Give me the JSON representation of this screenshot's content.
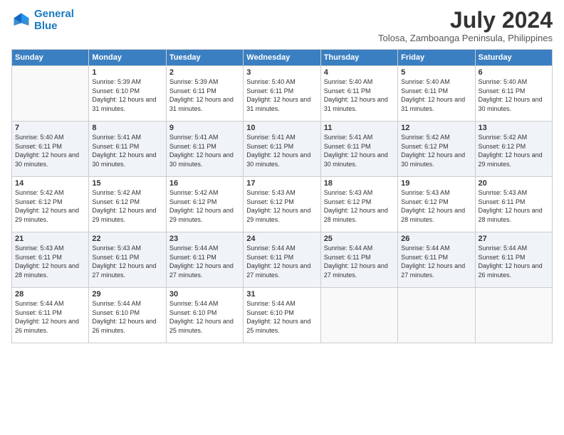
{
  "logo": {
    "line1": "General",
    "line2": "Blue"
  },
  "title": "July 2024",
  "location": "Tolosa, Zamboanga Peninsula, Philippines",
  "headers": [
    "Sunday",
    "Monday",
    "Tuesday",
    "Wednesday",
    "Thursday",
    "Friday",
    "Saturday"
  ],
  "weeks": [
    [
      {
        "day": "",
        "sunrise": "",
        "sunset": "",
        "daylight": ""
      },
      {
        "day": "1",
        "sunrise": "Sunrise: 5:39 AM",
        "sunset": "Sunset: 6:10 PM",
        "daylight": "Daylight: 12 hours and 31 minutes."
      },
      {
        "day": "2",
        "sunrise": "Sunrise: 5:39 AM",
        "sunset": "Sunset: 6:11 PM",
        "daylight": "Daylight: 12 hours and 31 minutes."
      },
      {
        "day": "3",
        "sunrise": "Sunrise: 5:40 AM",
        "sunset": "Sunset: 6:11 PM",
        "daylight": "Daylight: 12 hours and 31 minutes."
      },
      {
        "day": "4",
        "sunrise": "Sunrise: 5:40 AM",
        "sunset": "Sunset: 6:11 PM",
        "daylight": "Daylight: 12 hours and 31 minutes."
      },
      {
        "day": "5",
        "sunrise": "Sunrise: 5:40 AM",
        "sunset": "Sunset: 6:11 PM",
        "daylight": "Daylight: 12 hours and 31 minutes."
      },
      {
        "day": "6",
        "sunrise": "Sunrise: 5:40 AM",
        "sunset": "Sunset: 6:11 PM",
        "daylight": "Daylight: 12 hours and 30 minutes."
      }
    ],
    [
      {
        "day": "7",
        "sunrise": "Sunrise: 5:40 AM",
        "sunset": "Sunset: 6:11 PM",
        "daylight": "Daylight: 12 hours and 30 minutes."
      },
      {
        "day": "8",
        "sunrise": "Sunrise: 5:41 AM",
        "sunset": "Sunset: 6:11 PM",
        "daylight": "Daylight: 12 hours and 30 minutes."
      },
      {
        "day": "9",
        "sunrise": "Sunrise: 5:41 AM",
        "sunset": "Sunset: 6:11 PM",
        "daylight": "Daylight: 12 hours and 30 minutes."
      },
      {
        "day": "10",
        "sunrise": "Sunrise: 5:41 AM",
        "sunset": "Sunset: 6:11 PM",
        "daylight": "Daylight: 12 hours and 30 minutes."
      },
      {
        "day": "11",
        "sunrise": "Sunrise: 5:41 AM",
        "sunset": "Sunset: 6:11 PM",
        "daylight": "Daylight: 12 hours and 30 minutes."
      },
      {
        "day": "12",
        "sunrise": "Sunrise: 5:42 AM",
        "sunset": "Sunset: 6:12 PM",
        "daylight": "Daylight: 12 hours and 30 minutes."
      },
      {
        "day": "13",
        "sunrise": "Sunrise: 5:42 AM",
        "sunset": "Sunset: 6:12 PM",
        "daylight": "Daylight: 12 hours and 29 minutes."
      }
    ],
    [
      {
        "day": "14",
        "sunrise": "Sunrise: 5:42 AM",
        "sunset": "Sunset: 6:12 PM",
        "daylight": "Daylight: 12 hours and 29 minutes."
      },
      {
        "day": "15",
        "sunrise": "Sunrise: 5:42 AM",
        "sunset": "Sunset: 6:12 PM",
        "daylight": "Daylight: 12 hours and 29 minutes."
      },
      {
        "day": "16",
        "sunrise": "Sunrise: 5:42 AM",
        "sunset": "Sunset: 6:12 PM",
        "daylight": "Daylight: 12 hours and 29 minutes."
      },
      {
        "day": "17",
        "sunrise": "Sunrise: 5:43 AM",
        "sunset": "Sunset: 6:12 PM",
        "daylight": "Daylight: 12 hours and 29 minutes."
      },
      {
        "day": "18",
        "sunrise": "Sunrise: 5:43 AM",
        "sunset": "Sunset: 6:12 PM",
        "daylight": "Daylight: 12 hours and 28 minutes."
      },
      {
        "day": "19",
        "sunrise": "Sunrise: 5:43 AM",
        "sunset": "Sunset: 6:12 PM",
        "daylight": "Daylight: 12 hours and 28 minutes."
      },
      {
        "day": "20",
        "sunrise": "Sunrise: 5:43 AM",
        "sunset": "Sunset: 6:11 PM",
        "daylight": "Daylight: 12 hours and 28 minutes."
      }
    ],
    [
      {
        "day": "21",
        "sunrise": "Sunrise: 5:43 AM",
        "sunset": "Sunset: 6:11 PM",
        "daylight": "Daylight: 12 hours and 28 minutes."
      },
      {
        "day": "22",
        "sunrise": "Sunrise: 5:43 AM",
        "sunset": "Sunset: 6:11 PM",
        "daylight": "Daylight: 12 hours and 27 minutes."
      },
      {
        "day": "23",
        "sunrise": "Sunrise: 5:44 AM",
        "sunset": "Sunset: 6:11 PM",
        "daylight": "Daylight: 12 hours and 27 minutes."
      },
      {
        "day": "24",
        "sunrise": "Sunrise: 5:44 AM",
        "sunset": "Sunset: 6:11 PM",
        "daylight": "Daylight: 12 hours and 27 minutes."
      },
      {
        "day": "25",
        "sunrise": "Sunrise: 5:44 AM",
        "sunset": "Sunset: 6:11 PM",
        "daylight": "Daylight: 12 hours and 27 minutes."
      },
      {
        "day": "26",
        "sunrise": "Sunrise: 5:44 AM",
        "sunset": "Sunset: 6:11 PM",
        "daylight": "Daylight: 12 hours and 27 minutes."
      },
      {
        "day": "27",
        "sunrise": "Sunrise: 5:44 AM",
        "sunset": "Sunset: 6:11 PM",
        "daylight": "Daylight: 12 hours and 26 minutes."
      }
    ],
    [
      {
        "day": "28",
        "sunrise": "Sunrise: 5:44 AM",
        "sunset": "Sunset: 6:11 PM",
        "daylight": "Daylight: 12 hours and 26 minutes."
      },
      {
        "day": "29",
        "sunrise": "Sunrise: 5:44 AM",
        "sunset": "Sunset: 6:10 PM",
        "daylight": "Daylight: 12 hours and 26 minutes."
      },
      {
        "day": "30",
        "sunrise": "Sunrise: 5:44 AM",
        "sunset": "Sunset: 6:10 PM",
        "daylight": "Daylight: 12 hours and 25 minutes."
      },
      {
        "day": "31",
        "sunrise": "Sunrise: 5:44 AM",
        "sunset": "Sunset: 6:10 PM",
        "daylight": "Daylight: 12 hours and 25 minutes."
      },
      {
        "day": "",
        "sunrise": "",
        "sunset": "",
        "daylight": ""
      },
      {
        "day": "",
        "sunrise": "",
        "sunset": "",
        "daylight": ""
      },
      {
        "day": "",
        "sunrise": "",
        "sunset": "",
        "daylight": ""
      }
    ]
  ]
}
